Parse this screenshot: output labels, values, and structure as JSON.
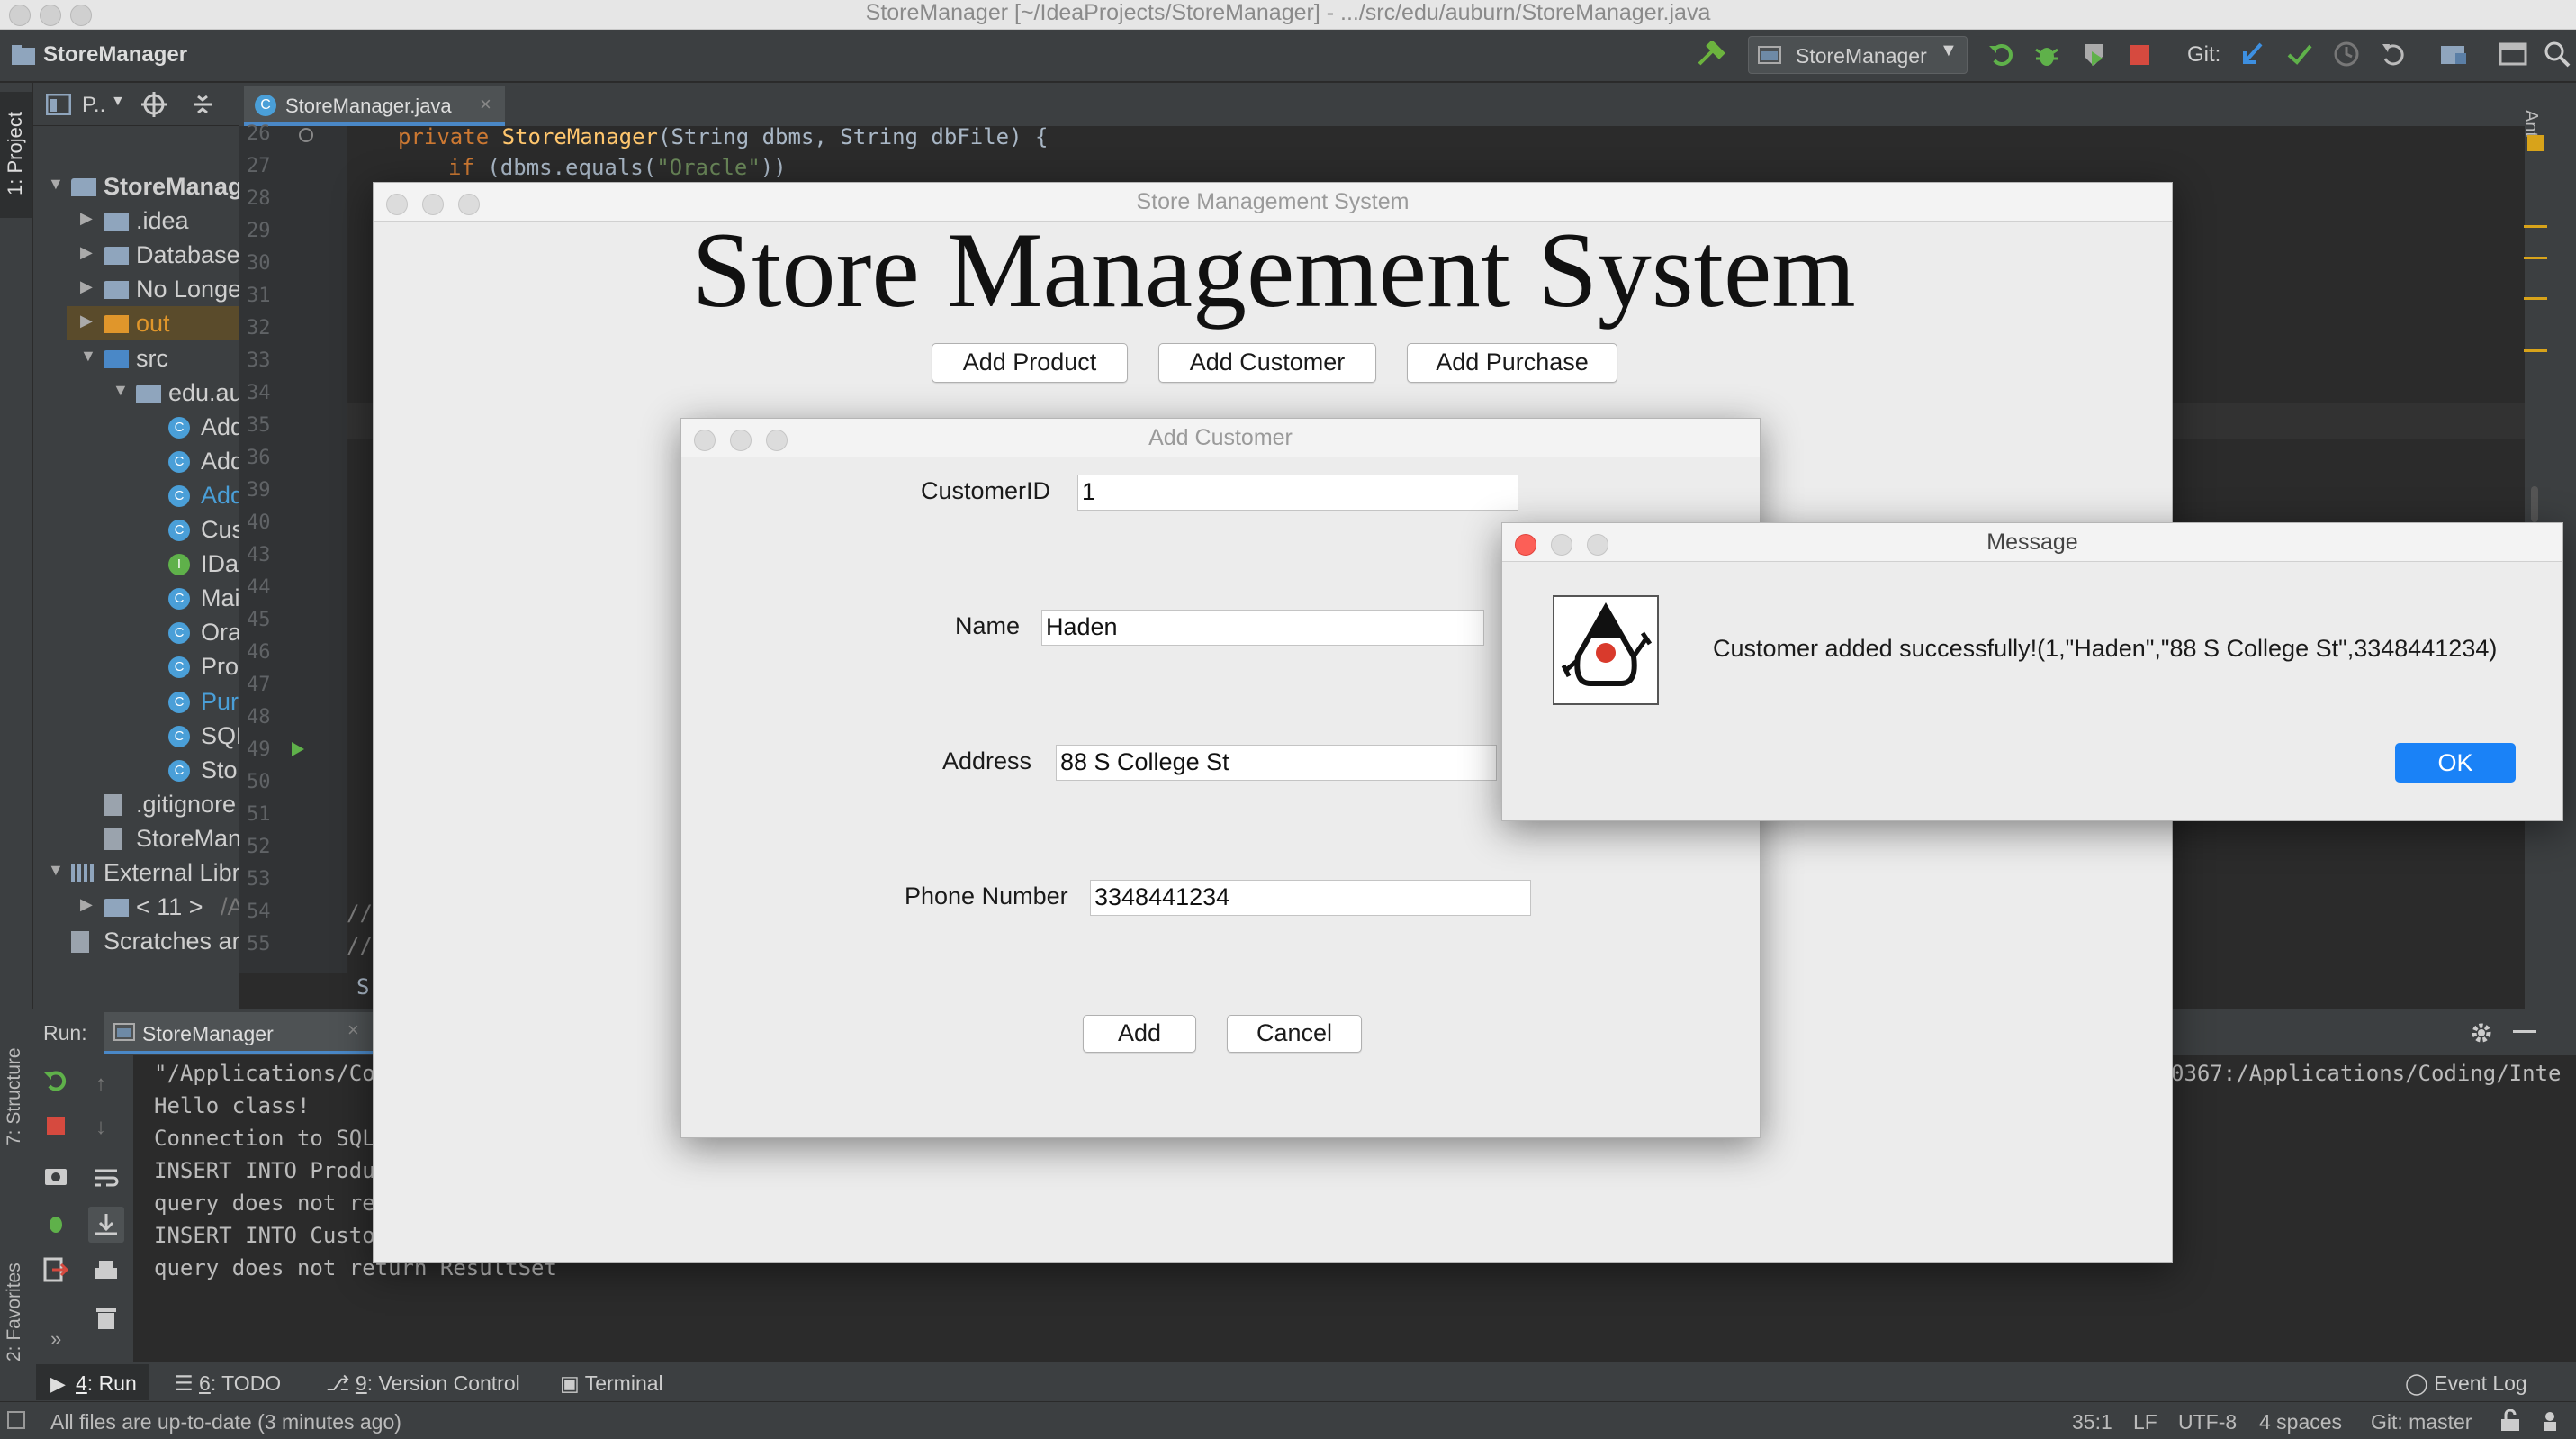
{
  "mac_window": {
    "title": "StoreManager [~/IdeaProjects/StoreManager] - .../src/edu/auburn/StoreManager.java"
  },
  "ide": {
    "project_name": "StoreManager",
    "run_config": "StoreManager",
    "git_label": "Git:",
    "left_tabs": [
      "1: Project",
      "7: Structure",
      "2: Favorites"
    ],
    "right_tab": "Ant",
    "project_panel_label": "P..",
    "editor_tab": "StoreManager.java",
    "project_tree": [
      {
        "label": "StoreManag",
        "kind": "root"
      },
      {
        "label": ".idea",
        "kind": "folder"
      },
      {
        "label": "Database",
        "kind": "folder"
      },
      {
        "label": "No Longe",
        "kind": "folder"
      },
      {
        "label": "out",
        "kind": "folder-out"
      },
      {
        "label": "src",
        "kind": "folder-src"
      },
      {
        "label": "edu.au",
        "kind": "package"
      },
      {
        "label": "Add",
        "kind": "class"
      },
      {
        "label": "Add",
        "kind": "class"
      },
      {
        "label": "Add",
        "kind": "class"
      },
      {
        "label": "Cus",
        "kind": "class"
      },
      {
        "label": "IDat",
        "kind": "interface"
      },
      {
        "label": "Mai",
        "kind": "class"
      },
      {
        "label": "Ora",
        "kind": "class"
      },
      {
        "label": "Pro",
        "kind": "class"
      },
      {
        "label": "Pur",
        "kind": "class"
      },
      {
        "label": "SQL",
        "kind": "class"
      },
      {
        "label": "Sto",
        "kind": "class"
      },
      {
        "label": ".gitignore",
        "kind": "file"
      },
      {
        "label": "StoreMan",
        "kind": "file"
      },
      {
        "label": "External Libr",
        "kind": "lib"
      },
      {
        "label": "< 11 >",
        "kind": "sdk",
        "suffix": "/A"
      },
      {
        "label": "Scratches ar",
        "kind": "scratch"
      }
    ],
    "line_numbers": [
      "26",
      "27",
      "28",
      "29",
      "30",
      "31",
      "32",
      "33",
      "34",
      "35",
      "36",
      "39",
      "40",
      "43",
      "44",
      "45",
      "46",
      "47",
      "48",
      "49",
      "50",
      "51",
      "52",
      "53",
      "54",
      "55"
    ],
    "code": {
      "line26_kw": "private",
      "line26_name": "StoreManager",
      "line26_rest": "(String dbms, String dbFile) {",
      "line27_kw": "if",
      "line27_call": "(dbms.equals(",
      "line27_str": "\"Oracle\"",
      "line27_end": "))",
      "comment": "//",
      "s_char": "S"
    },
    "run": {
      "label": "Run:",
      "tab": "StoreManager",
      "console_lines": [
        "\"/Applications/Co",
        "Hello class!",
        "Connection to SQL",
        "INSERT INTO Produ",
        "query does not re",
        "INSERT INTO Custo",
        "query does not return ResultSet"
      ],
      "console_right": "0367:/Applications/Coding/Inte",
      "more_glyph": "»"
    },
    "bottom_tabs": [
      {
        "num": "4",
        "label": ": Run"
      },
      {
        "num": "6",
        "label": ": TODO"
      },
      {
        "num": "9",
        "label": ": Version Control"
      },
      {
        "num": "",
        "label": "Terminal"
      }
    ],
    "event_log": "Event Log",
    "status": {
      "message": "All files are up-to-date (3 minutes ago)",
      "position": "35:1",
      "line_sep": "LF",
      "encoding": "UTF-8",
      "indent": "4 spaces",
      "git": "Git: master"
    }
  },
  "sms": {
    "window_title": "Store Management System",
    "heading": "Store Management System",
    "buttons": [
      "Add Product",
      "Add Customer",
      "Add Purchase"
    ]
  },
  "add_customer": {
    "window_title": "Add Customer",
    "fields": [
      {
        "label": "CustomerID",
        "value": "1"
      },
      {
        "label": "Name",
        "value": "Haden"
      },
      {
        "label": "Address",
        "value": "88 S College St"
      },
      {
        "label": "Phone Number",
        "value": "3348441234"
      }
    ],
    "add_label": "Add",
    "cancel_label": "Cancel"
  },
  "message": {
    "window_title": "Message",
    "text": "Customer added successfully!(1,\"Haden\",\"88 S College St\",3348441234)",
    "ok_label": "OK"
  },
  "colors": {
    "ide_bg": "#2b2b2b",
    "ide_panel": "#3c3f41",
    "ok_blue": "#1a82f7",
    "java_orange": "#f58219"
  }
}
